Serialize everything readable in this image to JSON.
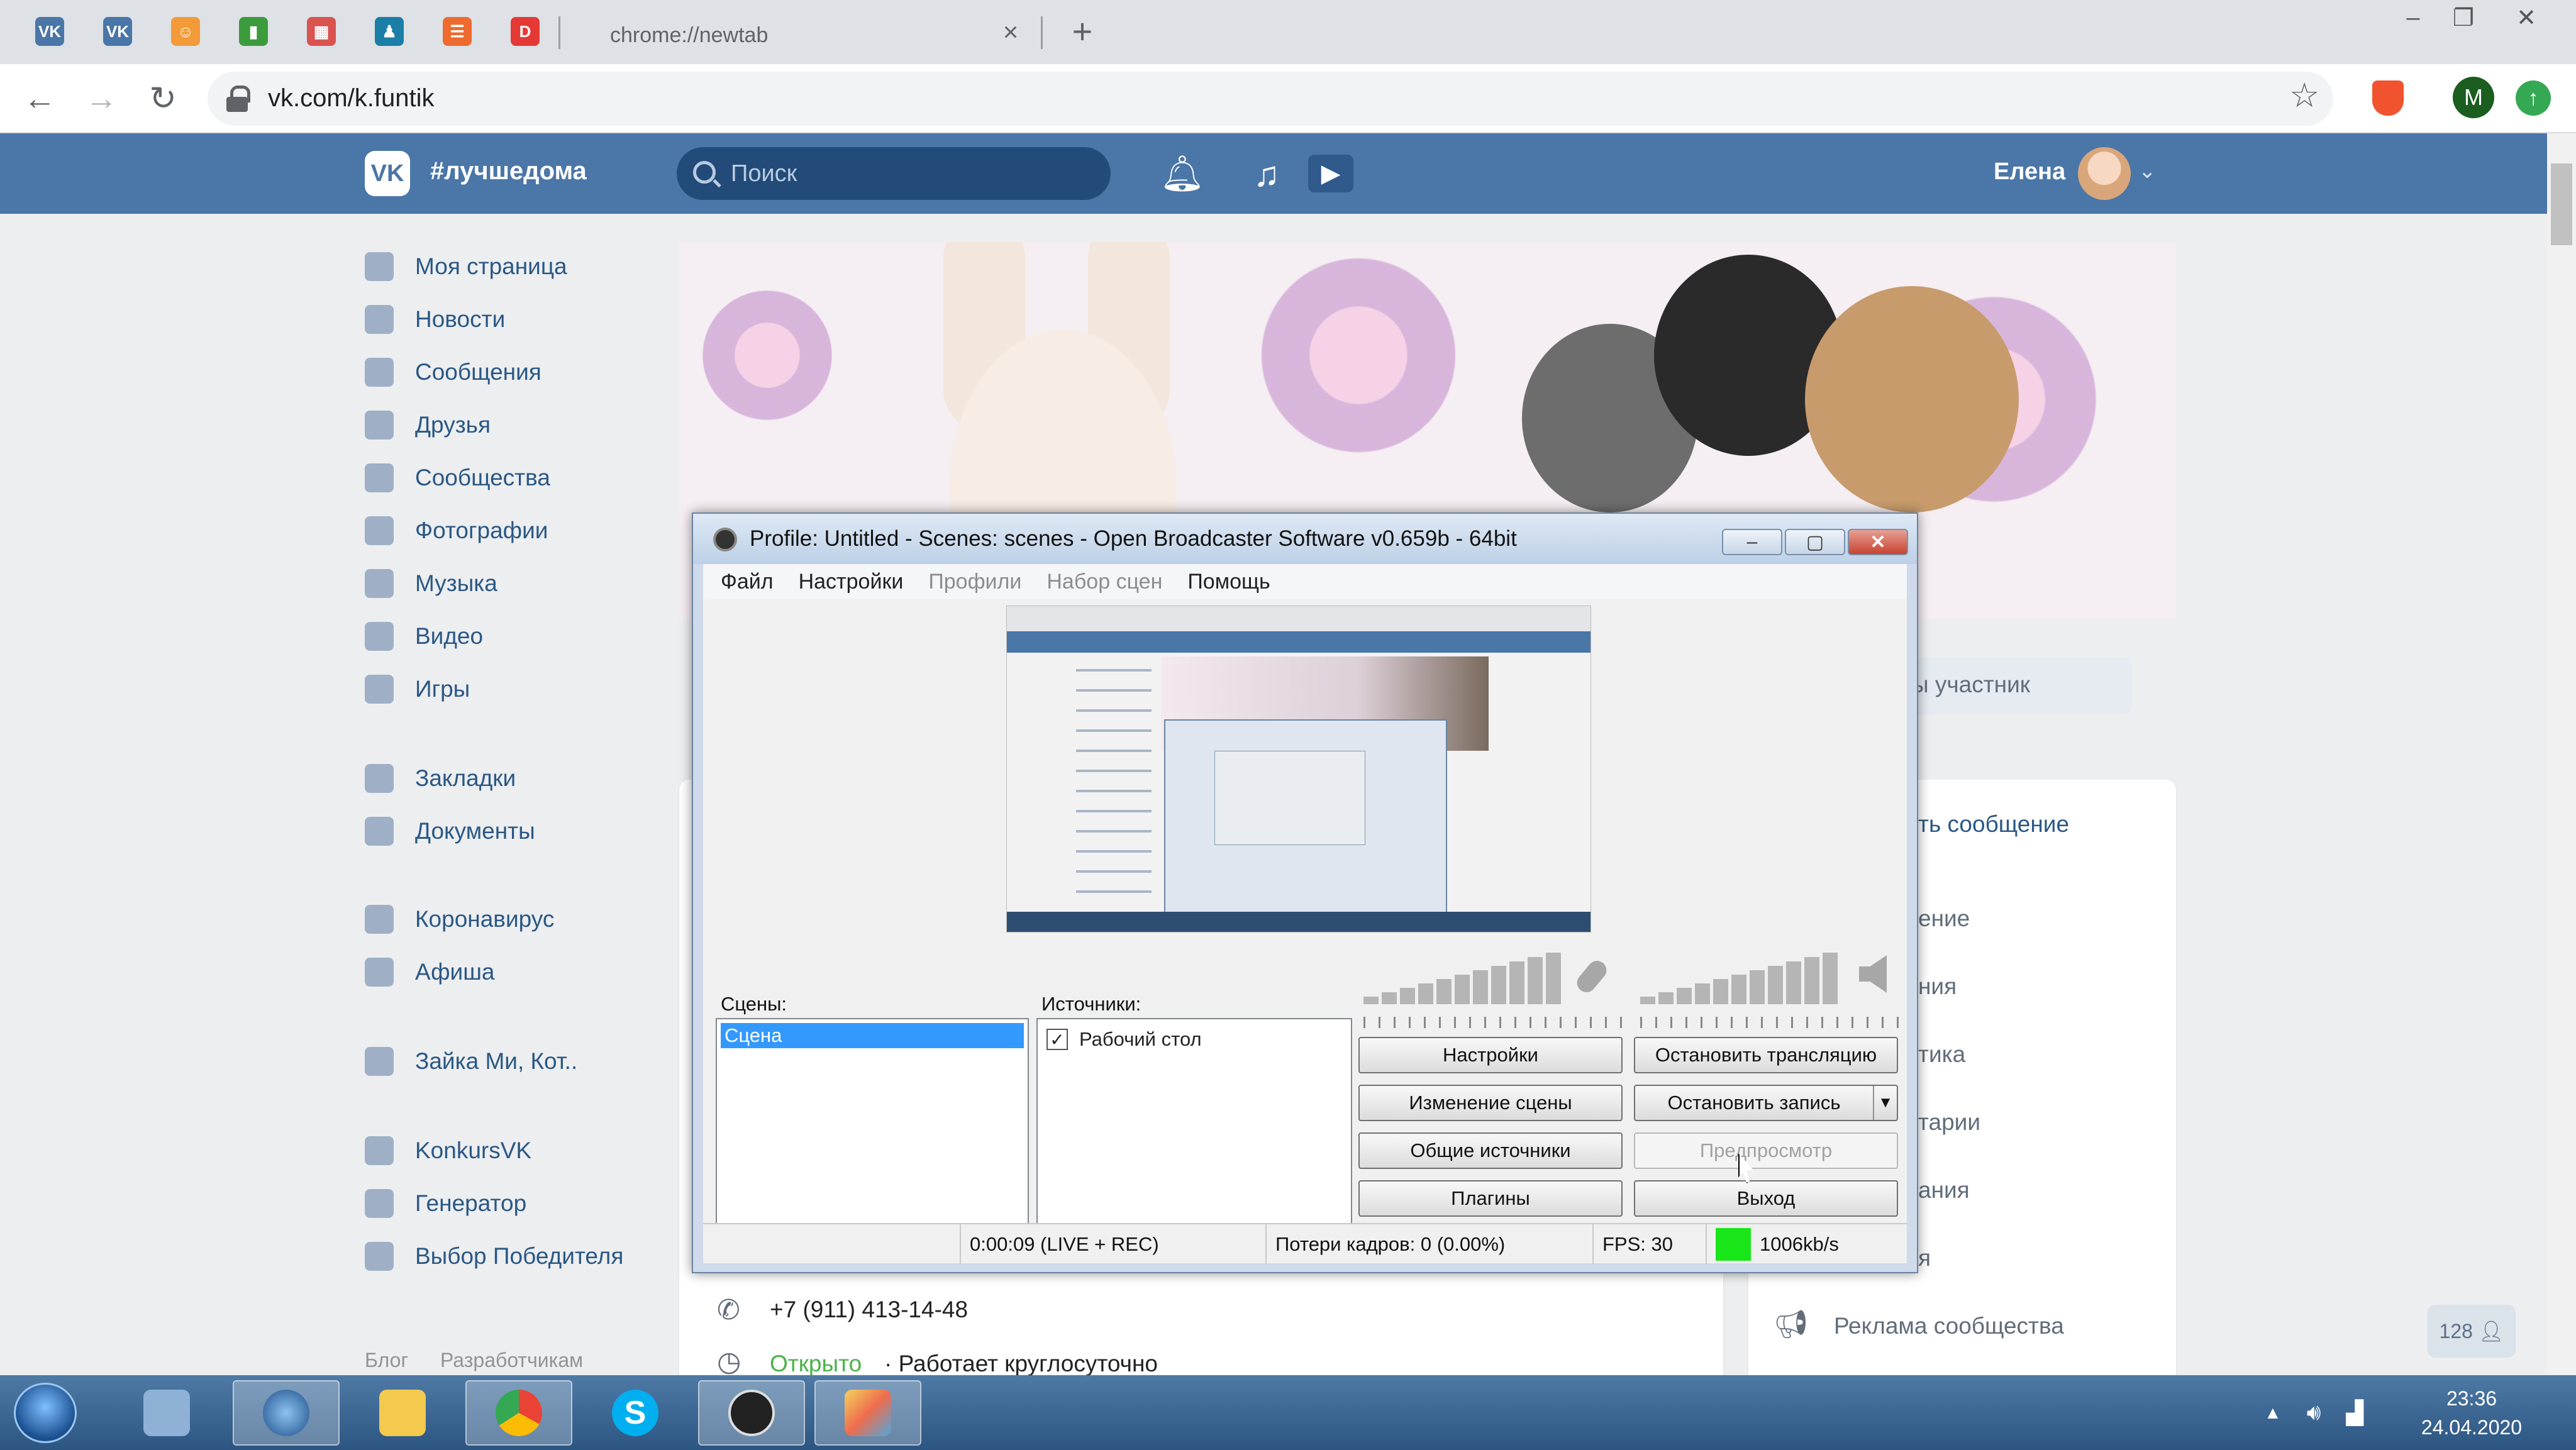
{
  "browser": {
    "pinned_tabs": [
      {
        "icon": "vk-icon",
        "color": "#4a76a8",
        "glyph": "VK"
      },
      {
        "icon": "vk-icon",
        "color": "#4a76a8",
        "glyph": "VK"
      },
      {
        "icon": "kid-icon",
        "color": "#f29b38",
        "glyph": "☺"
      },
      {
        "icon": "book-icon",
        "color": "#3c9b3c",
        "glyph": "▮"
      },
      {
        "icon": "film-icon",
        "color": "#d9534f",
        "glyph": "▦"
      },
      {
        "icon": "contact-icon",
        "color": "#1b7ea6",
        "glyph": "♟"
      },
      {
        "icon": "orange-app-icon",
        "color": "#ee6b2f",
        "glyph": "☰"
      },
      {
        "icon": "d-app-icon",
        "color": "#e53935",
        "glyph": "D"
      }
    ],
    "active_tab_title": "chrome://newtab",
    "address": "vk.com/k.funtik",
    "profile_letter": "M"
  },
  "vk": {
    "hashtag": "#лучшедома",
    "search_placeholder": "Поиск",
    "user_name": "Елена",
    "menu": [
      "Моя страница",
      "Новости",
      "Сообщения",
      "Друзья",
      "Сообщества",
      "Фотографии",
      "Музыка",
      "Видео",
      "Игры",
      "Закладки",
      "Документы",
      "Коронавирус",
      "Афиша",
      "Зайка Ми, Кот..",
      "KonkursVK",
      "Генератор",
      "Выбор Победителя"
    ],
    "footer_links": [
      "Блог",
      "Разработчикам"
    ],
    "participant_button": "ы участник",
    "write_message": "ть сообщение",
    "right_menu": [
      "ение",
      "ния",
      "тика",
      "тарии",
      "ания",
      "я"
    ],
    "ad_link": "Реклама сообщества",
    "phone": "+7 (911) 413-14-48",
    "open_status": "Открыто",
    "open_hours": "· Работает круглосуточно",
    "online_count": "128"
  },
  "obs": {
    "title": "Profile: Untitled - Scenes: scenes - Open Broadcaster Software v0.659b - 64bit",
    "menu": [
      {
        "label": "Файл",
        "enabled": true
      },
      {
        "label": "Настройки",
        "enabled": true
      },
      {
        "label": "Профили",
        "enabled": false
      },
      {
        "label": "Набор сцен",
        "enabled": false
      },
      {
        "label": "Помощь",
        "enabled": true
      }
    ],
    "scenes_label": "Сцены:",
    "sources_label": "Источники:",
    "scenes": [
      "Сцена"
    ],
    "sources": [
      {
        "label": "Рабочий стол",
        "checked": true
      }
    ],
    "buttons": {
      "settings": "Настройки",
      "stop_stream": "Остановить трансляцию",
      "edit_scene": "Изменение сцены",
      "stop_record": "Остановить запись",
      "global_sources": "Общие источники",
      "preview": "Предпросмотр",
      "plugins": "Плагины",
      "exit": "Выход"
    },
    "status": {
      "time": "0:00:09 (LIVE + REC)",
      "dropped": "Потери кадров: 0 (0.00%)",
      "fps": "FPS: 30",
      "bitrate": "1006kb/s",
      "bitrate_color": "#19e619"
    }
  },
  "taskbar": {
    "apps": [
      "thunderbird-icon",
      "calculator-icon",
      "explorer-icon",
      "chrome-icon",
      "skype-icon",
      "obs-icon",
      "paint-icon"
    ],
    "time": "23:36",
    "date": "24.04.2020"
  }
}
